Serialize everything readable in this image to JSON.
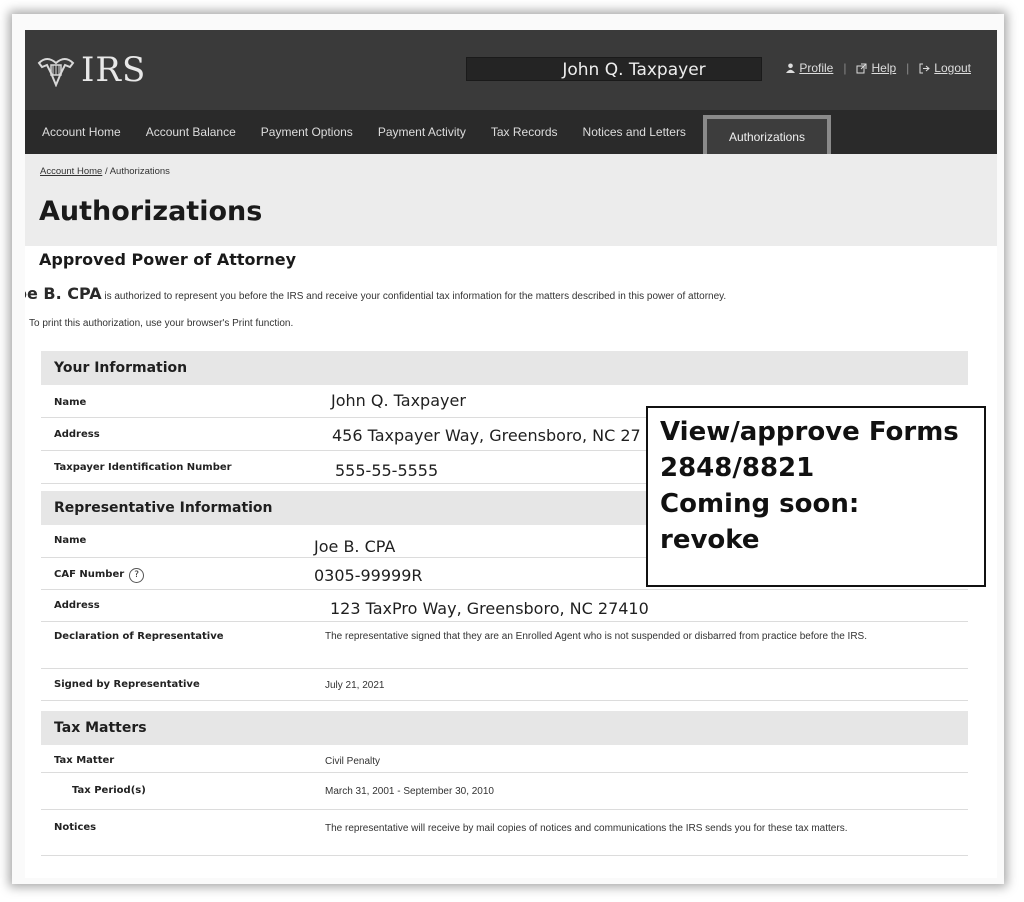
{
  "header": {
    "logo_text": "IRS",
    "user_name": "John Q. Taxpayer",
    "links": {
      "profile": "Profile",
      "help": "Help",
      "logout": "Logout"
    }
  },
  "nav": [
    "Account Home",
    "Account Balance",
    "Payment Options",
    "Payment Activity",
    "Tax Records",
    "Notices and Letters",
    "Authorizations"
  ],
  "breadcrumb": {
    "home": "Account Home",
    "sep": "/",
    "current": "Authorizations"
  },
  "page_title": "Authorizations",
  "subtitle": "Approved Power of Attorney",
  "intro": {
    "rep_name": "Joe B. CPA",
    "text": "is authorized to represent you before the IRS and receive your confidential tax information for the matters described in this power of attorney.",
    "print_note": "To print this authorization, use your browser's Print function."
  },
  "your_info": {
    "title": "Your Information",
    "name_label": "Name",
    "name": "John Q. Taxpayer",
    "address_label": "Address",
    "address": "456 Taxpayer Way, Greensboro, NC 27",
    "tin_label": "Taxpayer Identification Number",
    "tin": "555-55-5555"
  },
  "rep_info": {
    "title": "Representative Information",
    "name_label": "Name",
    "name": "Joe B. CPA",
    "caf_label": "CAF Number",
    "caf_help": "?",
    "caf": "0305-99999R",
    "address_label": "Address",
    "address": "123 TaxPro Way, Greensboro, NC 27410",
    "decl_label": "Declaration of Representative",
    "decl": "The representative signed that they are an Enrolled Agent who is not suspended or disbarred from practice before the IRS.",
    "signed_label": "Signed by Representative",
    "signed": "July 21, 2021"
  },
  "tax_matters": {
    "title": "Tax Matters",
    "matter_label": "Tax Matter",
    "matter": "Civil Penalty",
    "period_label": "Tax Period(s)",
    "period": "March 31, 2001 - September 30, 2010",
    "notices_label": "Notices",
    "notices": "The representative will receive by mail copies of notices and communications the IRS sends you for these tax matters."
  },
  "callout": [
    "View/approve Forms",
    "2848/8821",
    "Coming soon:",
    "revoke"
  ]
}
